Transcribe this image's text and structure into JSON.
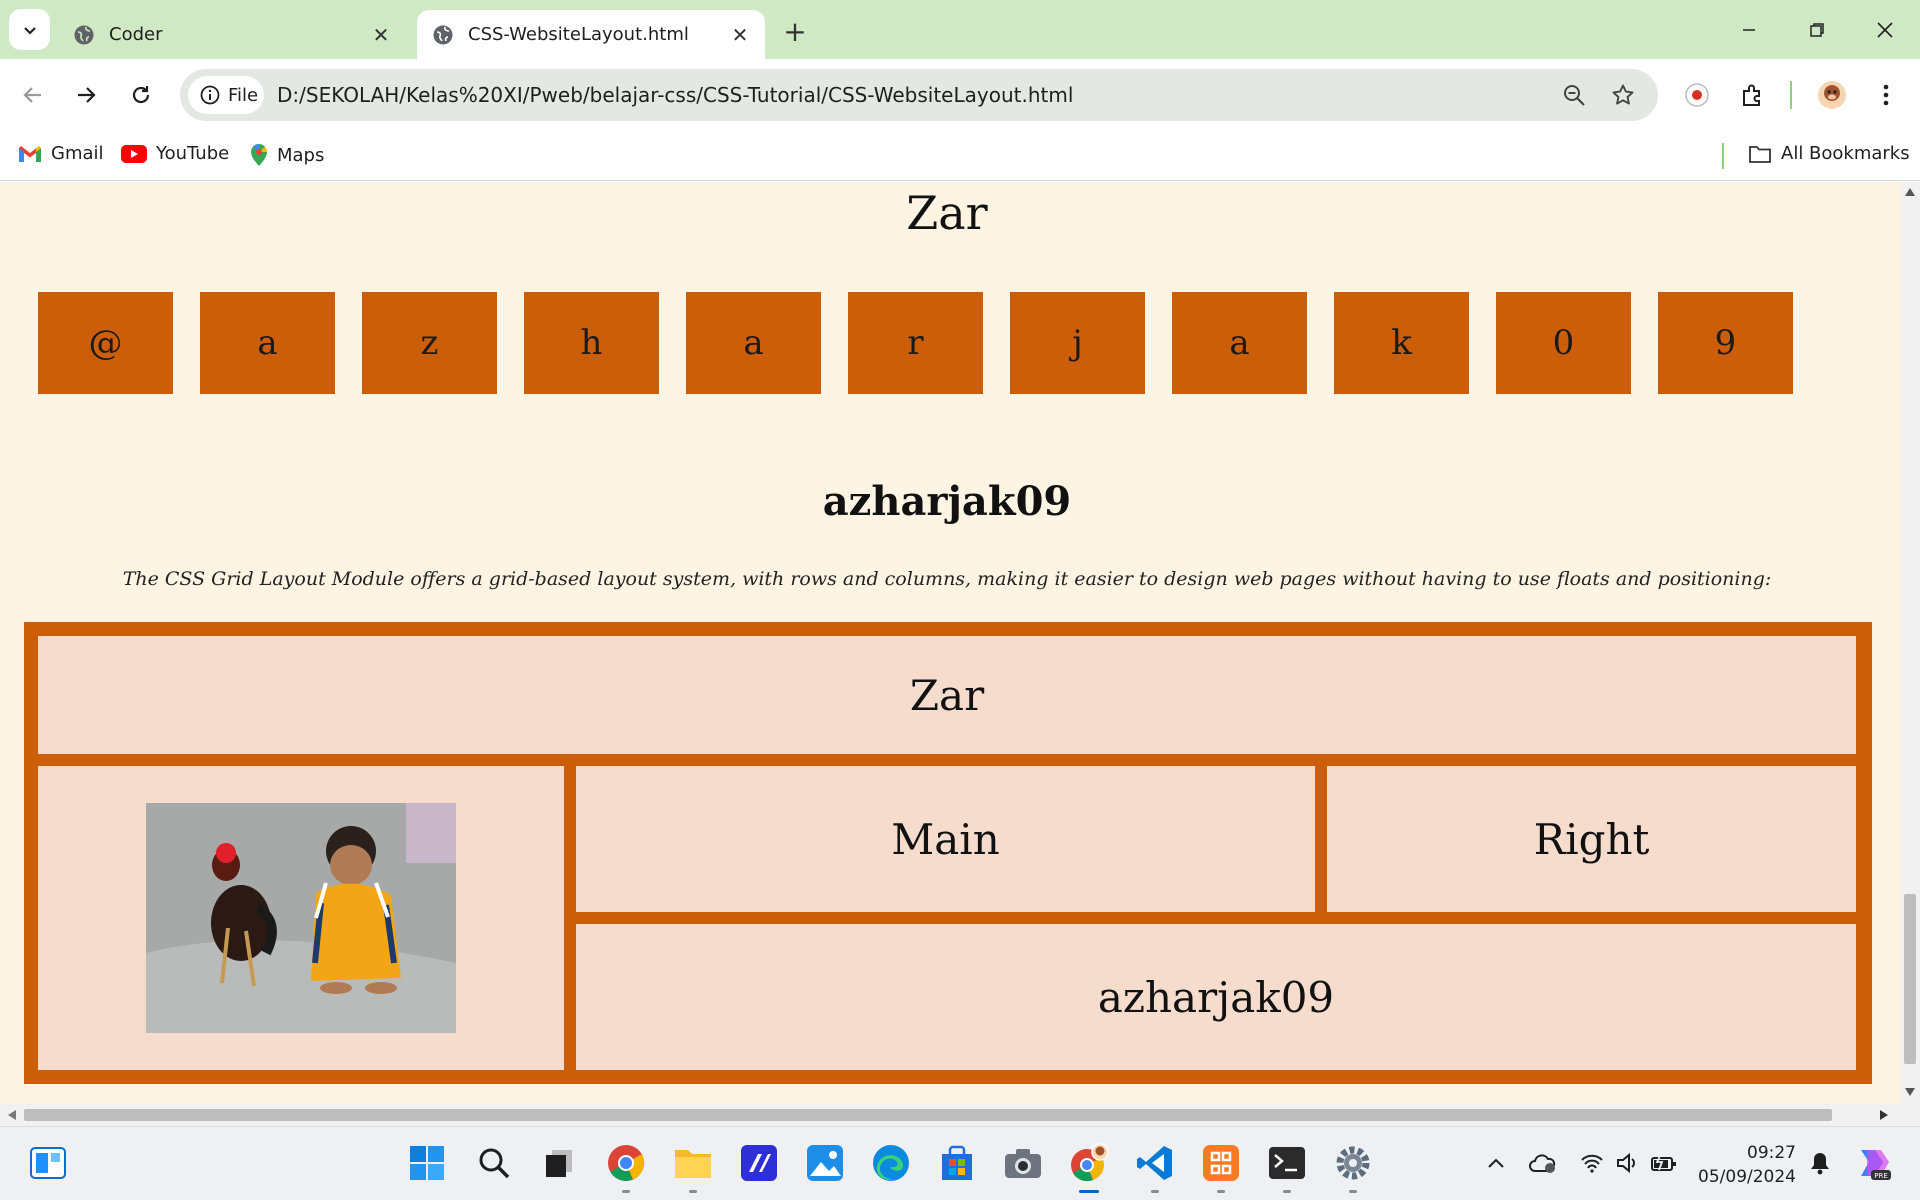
{
  "browser": {
    "tabs": [
      {
        "title": "Coder",
        "active": false
      },
      {
        "title": "CSS-WebsiteLayout.html",
        "active": true
      }
    ],
    "omnibox": {
      "scheme_chip": "File",
      "url": "D:/SEKOLAH/Kelas%20XI/Pweb/belajar-css/CSS-Tutorial/CSS-WebsiteLayout.html"
    },
    "bookmarks": [
      {
        "label": "Gmail",
        "icon": "gmail-icon"
      },
      {
        "label": "YouTube",
        "icon": "youtube-icon"
      },
      {
        "label": "Maps",
        "icon": "maps-icon"
      }
    ],
    "all_bookmarks": "All Bookmarks"
  },
  "page": {
    "top_title": "Zar",
    "flex_letters": [
      "@",
      "a",
      "z",
      "h",
      "a",
      "r",
      "j",
      "a",
      "k",
      "0",
      "9"
    ],
    "heading": "azharjak09",
    "description": "The CSS Grid Layout Module offers a grid-based layout system, with rows and columns, making it easier to design web pages without having to use floats and positioning:",
    "grid": {
      "header": "Zar",
      "main": "Main",
      "right": "Right",
      "footer": "azharjak09"
    }
  },
  "colors": {
    "page_bg": "#fdf4e3",
    "accent_orange": "#cc5e0a",
    "grid_cell_bg": "#f6dccc",
    "tabstrip_bg": "#cfe9c4"
  },
  "taskbar": {
    "time": "09:27",
    "date": "05/09/2024"
  }
}
